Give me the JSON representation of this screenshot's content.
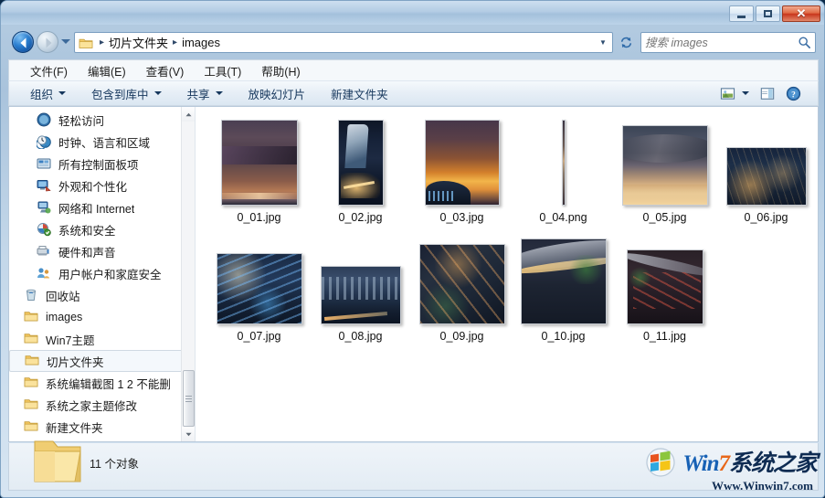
{
  "window": {
    "controls": {
      "minimize": "—",
      "maximize": "□",
      "close": "✕"
    }
  },
  "navigation": {
    "back_icon": "back-arrow-icon",
    "forward_icon": "forward-arrow-icon",
    "recent_dropdown_icon": "chevron-down-icon",
    "refresh_icon": "refresh-icon",
    "breadcrumb": {
      "folder_icon": "folder-icon",
      "separator": "▸",
      "items": [
        {
          "label": "切片文件夹"
        },
        {
          "label": "images"
        }
      ]
    },
    "address_chevron": "▼"
  },
  "search": {
    "placeholder": "搜索 images",
    "value": "",
    "icon": "search-icon"
  },
  "menubar": {
    "items": [
      {
        "label": "文件(F)"
      },
      {
        "label": "编辑(E)"
      },
      {
        "label": "查看(V)"
      },
      {
        "label": "工具(T)"
      },
      {
        "label": "帮助(H)"
      }
    ]
  },
  "toolbar": {
    "items": [
      {
        "label": "组织",
        "has_caret": true
      },
      {
        "label": "包含到库中",
        "has_caret": true
      },
      {
        "label": "共享",
        "has_caret": true
      },
      {
        "label": "放映幻灯片",
        "has_caret": false
      },
      {
        "label": "新建文件夹",
        "has_caret": false
      }
    ],
    "right_icons": [
      {
        "name": "change-view-icon"
      },
      {
        "name": "view-dropdown-caret"
      },
      {
        "name": "preview-pane-icon"
      },
      {
        "name": "help-icon"
      }
    ]
  },
  "sidebar": {
    "items": [
      {
        "label": "轻松访问",
        "icon": "ease-of-access-icon",
        "indent": 2,
        "selected": false
      },
      {
        "label": "时钟、语言和区域",
        "icon": "clock-language-region-icon",
        "indent": 2,
        "selected": false
      },
      {
        "label": "所有控制面板项",
        "icon": "all-control-panel-items-icon",
        "indent": 2,
        "selected": false
      },
      {
        "label": "外观和个性化",
        "icon": "appearance-personalization-icon",
        "indent": 2,
        "selected": false
      },
      {
        "label": "网络和 Internet",
        "icon": "network-internet-icon",
        "indent": 2,
        "selected": false
      },
      {
        "label": "系统和安全",
        "icon": "system-security-icon",
        "indent": 2,
        "selected": false
      },
      {
        "label": "硬件和声音",
        "icon": "hardware-sound-icon",
        "indent": 2,
        "selected": false
      },
      {
        "label": "用户帐户和家庭安全",
        "icon": "user-accounts-family-safety-icon",
        "indent": 2,
        "selected": false
      },
      {
        "label": "回收站",
        "icon": "recycle-bin-icon",
        "indent": 1,
        "selected": false
      },
      {
        "label": "images",
        "icon": "folder-icon",
        "indent": 1,
        "selected": false
      },
      {
        "label": "Win7主题",
        "icon": "folder-icon",
        "indent": 1,
        "selected": false
      },
      {
        "label": "切片文件夹",
        "icon": "folder-icon",
        "indent": 1,
        "selected": true
      },
      {
        "label": "系统编辑截图 1 2 不能删",
        "icon": "folder-icon",
        "indent": 1,
        "selected": false
      },
      {
        "label": "系统之家主题修改",
        "icon": "folder-icon",
        "indent": 1,
        "selected": false
      },
      {
        "label": "新建文件夹",
        "icon": "folder-icon",
        "indent": 1,
        "selected": false
      }
    ],
    "scrollbar": {
      "up_arrow": "▲",
      "down_arrow": "▼"
    }
  },
  "files": [
    {
      "name": "0_01.jpg",
      "thumb_w": 84,
      "thumb_h": 94,
      "style": "storm-clouds-sunset"
    },
    {
      "name": "0_02.jpg",
      "thumb_w": 50,
      "thumb_h": 94,
      "style": "tall-skyscraper-night"
    },
    {
      "name": "0_03.jpg",
      "thumb_w": 82,
      "thumb_h": 94,
      "style": "orange-sunset-city"
    },
    {
      "name": "0_04.png",
      "thumb_w": 4,
      "thumb_h": 94,
      "style": "thin-sliver"
    },
    {
      "name": "0_05.jpg",
      "thumb_w": 94,
      "thumb_h": 88,
      "style": "dramatic-cloud-sunset"
    },
    {
      "name": "0_06.jpg",
      "thumb_w": 88,
      "thumb_h": 64,
      "style": "aerial-city-night"
    },
    {
      "name": "0_07.jpg",
      "thumb_w": 94,
      "thumb_h": 78,
      "style": "blue-lit-cityscape"
    },
    {
      "name": "0_08.jpg",
      "thumb_w": 88,
      "thumb_h": 64,
      "style": "city-skyline-dusk"
    },
    {
      "name": "0_09.jpg",
      "thumb_w": 94,
      "thumb_h": 88,
      "style": "highway-interchange-night"
    },
    {
      "name": "0_10.jpg",
      "thumb_w": 94,
      "thumb_h": 94,
      "style": "curved-road-lights"
    },
    {
      "name": "0_11.jpg",
      "thumb_w": 84,
      "thumb_h": 82,
      "style": "road-traffic-trails"
    }
  ],
  "status": {
    "folder_icon": "large-folder-icon",
    "text": "11 个对象"
  },
  "watermark": {
    "logo_icon": "windows-logo-icon",
    "title_part1": "Win",
    "title_part2": "7",
    "title_part3": "系统之家",
    "url": "Www.Winwin7.com"
  },
  "colors": {
    "accent": "#1761b5",
    "close_button": "#c8361c",
    "title_bar": "#a9c3dc",
    "selection": "#cfe4f7"
  }
}
